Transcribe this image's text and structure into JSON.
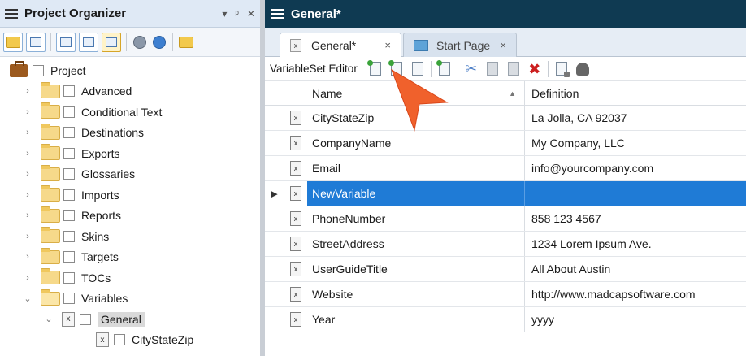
{
  "left_panel": {
    "title": "Project Organizer",
    "controls": {
      "menu": "▾",
      "pin": "ᵖ",
      "close": "✕"
    },
    "tree": [
      {
        "label": "Project",
        "kind": "root",
        "expanded": null
      },
      {
        "label": "Advanced",
        "kind": "folder",
        "expanded": false
      },
      {
        "label": "Conditional Text",
        "kind": "folder",
        "expanded": false
      },
      {
        "label": "Destinations",
        "kind": "folder",
        "expanded": false
      },
      {
        "label": "Exports",
        "kind": "folder",
        "expanded": false
      },
      {
        "label": "Glossaries",
        "kind": "folder",
        "expanded": false
      },
      {
        "label": "Imports",
        "kind": "folder",
        "expanded": false
      },
      {
        "label": "Reports",
        "kind": "folder",
        "expanded": false
      },
      {
        "label": "Skins",
        "kind": "folder",
        "expanded": false
      },
      {
        "label": "Targets",
        "kind": "folder",
        "expanded": false
      },
      {
        "label": "TOCs",
        "kind": "folder",
        "expanded": false
      },
      {
        "label": "Variables",
        "kind": "folder",
        "expanded": true
      },
      {
        "label": "General",
        "kind": "variableset",
        "expanded": true,
        "selected": true
      },
      {
        "label": "CityStateZip",
        "kind": "variable"
      }
    ]
  },
  "right_panel": {
    "title": "General*",
    "tabs": [
      {
        "label": "General*",
        "close": "×",
        "active": true
      },
      {
        "label": "Start Page",
        "close": "×",
        "active": false
      }
    ],
    "toolbar_label": "VariableSet Editor",
    "columns": {
      "name": "Name",
      "definition": "Definition"
    },
    "rows": [
      {
        "name": "CityStateZip",
        "definition": "La Jolla, CA 92037",
        "icon": "variable-icon"
      },
      {
        "name": "CompanyName",
        "definition": "My Company, LLC",
        "icon": "variable-icon"
      },
      {
        "name": "Email",
        "definition": "info@yourcompany.com",
        "icon": "variable-icon"
      },
      {
        "name": "NewVariable",
        "definition": "",
        "icon": "variable-icon",
        "selected": true
      },
      {
        "name": "PhoneNumber",
        "definition": "858 123 4567",
        "icon": "variable-icon"
      },
      {
        "name": "StreetAddress",
        "definition": "1234 Lorem Ipsum Ave.",
        "icon": "variable-icon"
      },
      {
        "name": "UserGuideTitle",
        "definition": "All About Austin",
        "icon": "variable-icon"
      },
      {
        "name": "Website",
        "definition": "http://www.madcapsoftware.com",
        "icon": "variable-icon"
      },
      {
        "name": "Year",
        "definition": "yyyy",
        "icon": "datetime-variable-icon"
      }
    ]
  },
  "colors": {
    "selection": "#1f7bd6",
    "title_bar_dark": "#0f3a52",
    "pointer": "#f0612c"
  }
}
